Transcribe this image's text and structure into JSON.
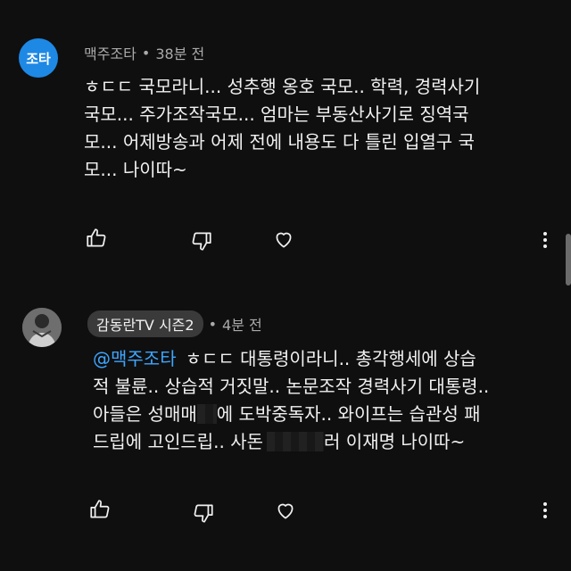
{
  "comments": [
    {
      "avatar_text": "조타",
      "author": "맥주조타",
      "separator": "•",
      "time": "38분 전",
      "lines": [
        "ㅎㄷㄷ 국모라니... 성추행 옹호 국모.. 학력, 경력사기",
        "국모... 주가조작국모... 엄마는 부동산사기로 징역국",
        "모... 어제방송과 어제 전에 내용도 다 틀린 입열구 국",
        "모... 나이따~"
      ],
      "actions": [
        "like-icon",
        "dislike-icon",
        "heart-icon",
        "more-vert-icon"
      ]
    },
    {
      "author": "감동란TV 시즌2",
      "separator": "•",
      "time": "4분 전",
      "mention": "@맥주조타",
      "line1_rest": "ㅎㄷㄷ 대통령이라니.. 총각행세에 상습",
      "line2": "적 불륜.. 상습적 거짓말.. 논문조작 경력사기 대통령..",
      "line3_a": "아들은 성매매",
      "line3_b": "에 도박중독자.. 와이프는 습관성 패",
      "line4": "드립에 고인드립.. 사돈",
      "line5_a": "사돈 ",
      "line5_b": "러 이재명 나이따~",
      "actions": [
        "like-icon",
        "dislike-icon",
        "heart-icon",
        "more-vert-icon"
      ]
    }
  ]
}
